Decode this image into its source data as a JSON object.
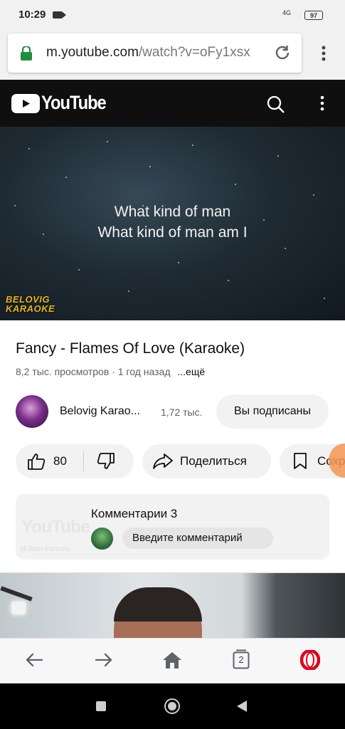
{
  "status_bar": {
    "time": "10:29",
    "network": "4G",
    "battery": "97"
  },
  "browser": {
    "url_host": "m.youtube.com",
    "url_path": "/watch?v=oFy1xsx",
    "tabs_count": "2"
  },
  "youtube": {
    "wordmark": "YouTube"
  },
  "video": {
    "lyric_line_1": "What kind of man",
    "lyric_line_2": "What kind of man am I",
    "watermark_line_1": "BELOVIG",
    "watermark_line_2": "KARAOKE",
    "title": "Fancy - Flames Of Love (Karaoke)",
    "views": "8,2 тыс. просмотров",
    "age": "1 год назад",
    "more": "...ещё"
  },
  "channel": {
    "name": "Belovig Karao...",
    "subscribers": "1,72 тыс.",
    "subscribe_button": "Вы подписаны"
  },
  "actions": {
    "likes": "80",
    "share_label": "Поделиться",
    "save_label": "Сохр"
  },
  "comments": {
    "title": "Комментарии 3",
    "placeholder": "Введите комментарий",
    "ghost_logo": "YouTube",
    "ghost_handle": "@Jean-francois"
  },
  "colors": {
    "youtube_red": "#ff0000",
    "header_bg": "#0f0f0f",
    "pill_bg": "#f2f2f2",
    "watermark": "#e8b620",
    "opera_red": "#e0001b",
    "lock_green": "#1e8e3e"
  },
  "icons": {
    "lock": "lock-icon",
    "reload": "reload-icon",
    "search": "search-icon",
    "like": "thumbs-up-icon",
    "dislike": "thumbs-down-icon",
    "share": "share-icon",
    "save": "bookmark-icon",
    "opera": "opera-icon"
  }
}
